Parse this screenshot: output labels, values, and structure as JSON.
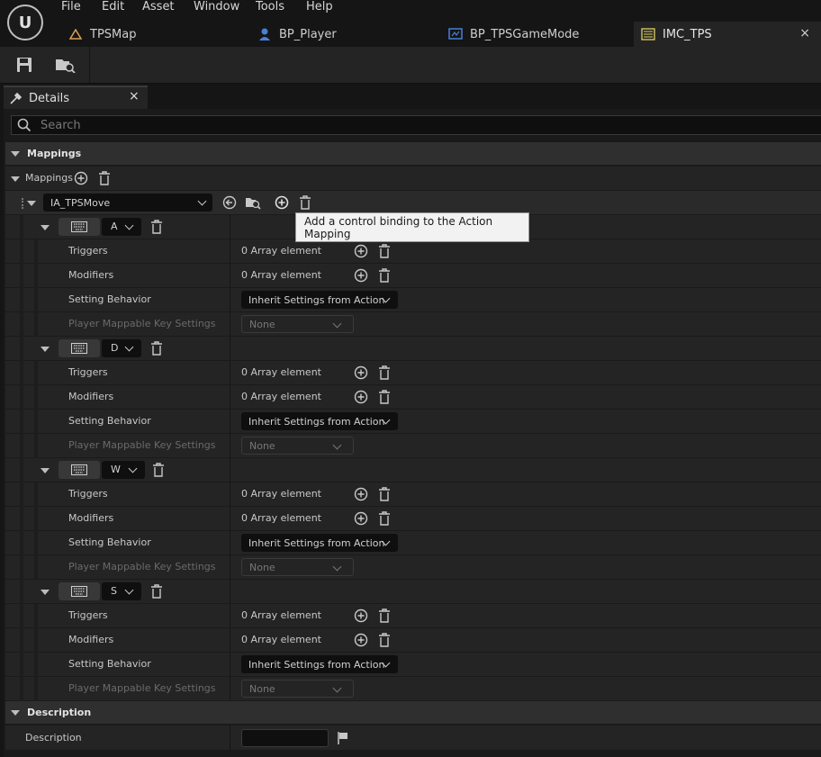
{
  "menu": [
    "File",
    "Edit",
    "Asset",
    "Window",
    "Tools",
    "Help"
  ],
  "tabs": [
    {
      "label": "TPSMap",
      "icon": "level-icon"
    },
    {
      "label": "BP_Player",
      "icon": "pawn-icon"
    },
    {
      "label": "BP_TPSGameMode",
      "icon": "blueprint-icon"
    },
    {
      "label": "IMC_TPS",
      "icon": "input-mapping-icon",
      "active": true
    }
  ],
  "toolbar": {
    "buttons": [
      "save-icon",
      "browse-icon"
    ]
  },
  "details": {
    "tab_label": "Details",
    "search_placeholder": "Search",
    "category_mappings": "Mappings",
    "mappings_label": "Mappings",
    "action": "IA_TPSMove",
    "tooltip": "Add a control binding to the Action Mapping",
    "keys": [
      {
        "key": "A",
        "triggers_label": "Triggers",
        "triggers_value": "0 Array element",
        "modifiers_label": "Modifiers",
        "modifiers_value": "0 Array element",
        "behavior_label": "Setting Behavior",
        "behavior_value": "Inherit Settings from Action",
        "pmk_label": "Player Mappable Key Settings",
        "pmk_value": "None"
      },
      {
        "key": "D",
        "triggers_label": "Triggers",
        "triggers_value": "0 Array element",
        "modifiers_label": "Modifiers",
        "modifiers_value": "0 Array element",
        "behavior_label": "Setting Behavior",
        "behavior_value": "Inherit Settings from Action",
        "pmk_label": "Player Mappable Key Settings",
        "pmk_value": "None"
      },
      {
        "key": "W",
        "triggers_label": "Triggers",
        "triggers_value": "0 Array element",
        "modifiers_label": "Modifiers",
        "modifiers_value": "0 Array element",
        "behavior_label": "Setting Behavior",
        "behavior_value": "Inherit Settings from Action",
        "pmk_label": "Player Mappable Key Settings",
        "pmk_value": "None"
      },
      {
        "key": "S",
        "triggers_label": "Triggers",
        "triggers_value": "0 Array element",
        "modifiers_label": "Modifiers",
        "modifiers_value": "0 Array element",
        "behavior_label": "Setting Behavior",
        "behavior_value": "Inherit Settings from Action",
        "pmk_label": "Player Mappable Key Settings",
        "pmk_value": "None"
      }
    ],
    "category_description": "Description",
    "description_label": "Description",
    "description_value": ""
  },
  "colors": {
    "background": "#151515",
    "panel": "#242424",
    "category": "#2f2f2f",
    "tooltip": "#f2f2f2"
  }
}
